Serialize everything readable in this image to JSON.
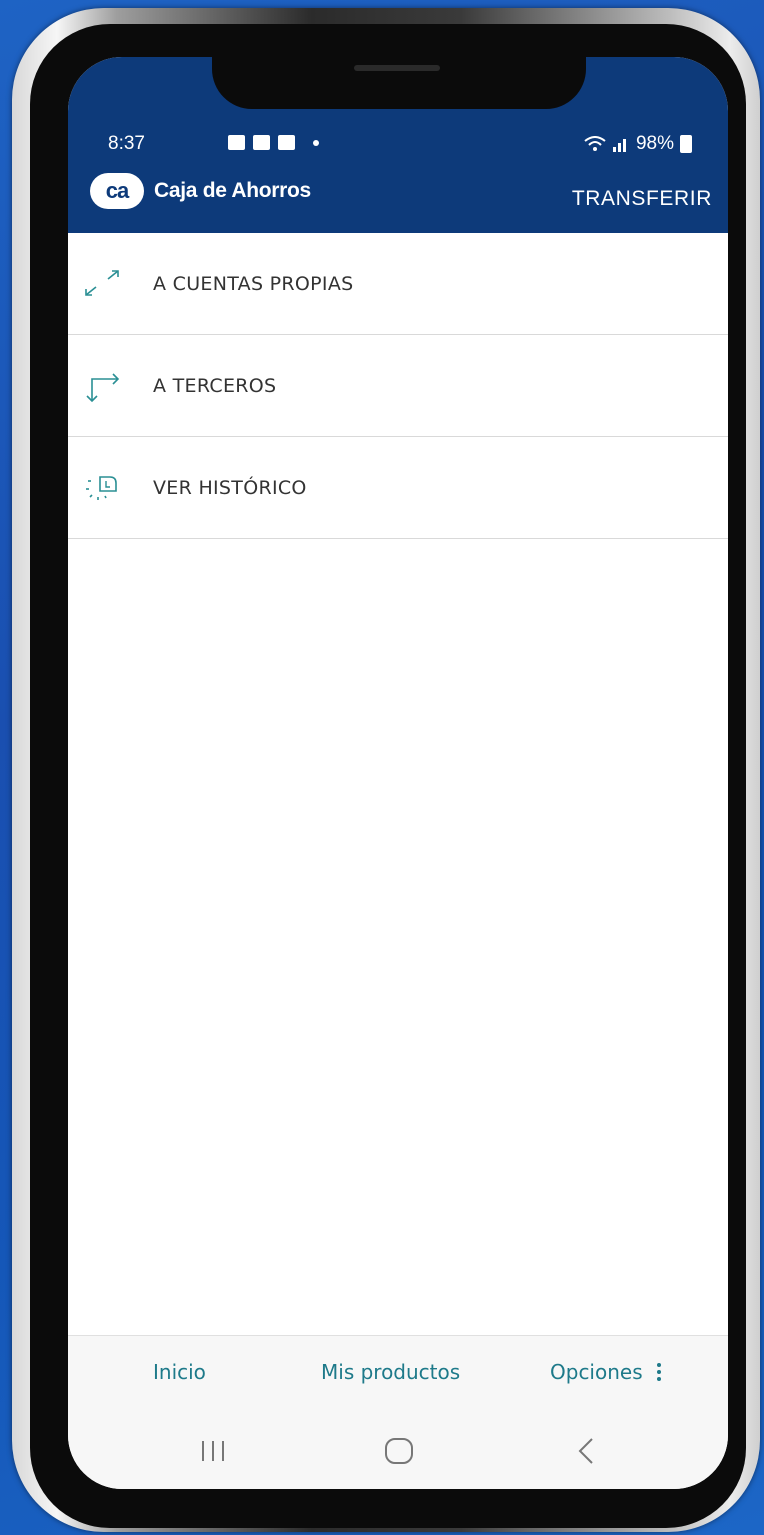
{
  "status_bar": {
    "time": "8:37",
    "battery": "98%"
  },
  "header": {
    "brand_logo_text": "ca",
    "brand_name": "Caja de Ahorros",
    "title": "TRANSFERIR",
    "background_color": "#0d3a7a"
  },
  "menu": {
    "items": [
      {
        "label": "A CUENTAS PROPIAS",
        "icon": "swap-arrows-icon"
      },
      {
        "label": "A TERCEROS",
        "icon": "corner-arrows-icon"
      },
      {
        "label": "VER HISTÓRICO",
        "icon": "history-icon"
      }
    ],
    "icon_color": "#2a8f94"
  },
  "bottom_nav": {
    "items": [
      {
        "label": "Inicio"
      },
      {
        "label": "Mis productos"
      },
      {
        "label": "Opciones"
      }
    ],
    "color": "#1e7a8a"
  },
  "system_nav": {
    "recents_icon": "recents-icon",
    "home_icon": "home-icon",
    "back_icon": "back-icon"
  }
}
